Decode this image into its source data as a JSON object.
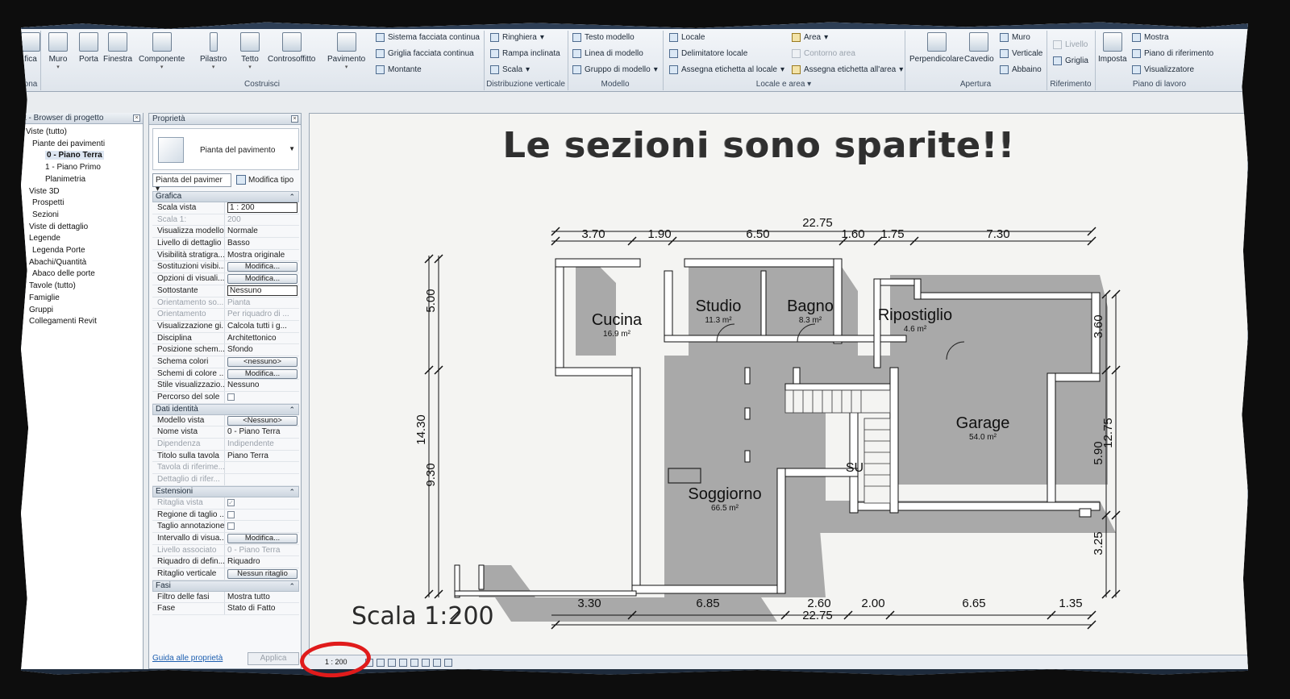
{
  "ribbon": {
    "big_tools": [
      {
        "label": "fica",
        "icon": "modify-icon"
      },
      {
        "label": "Muro",
        "icon": "wall-icon"
      },
      {
        "label": "Porta",
        "icon": "door-icon"
      },
      {
        "label": "Finestra",
        "icon": "window-icon"
      },
      {
        "label": "Componente",
        "icon": "component-icon"
      },
      {
        "label": "Pilastro",
        "icon": "column-icon"
      },
      {
        "label": "Tetto",
        "icon": "roof-icon"
      },
      {
        "label": "Controsoffitto",
        "icon": "ceiling-icon"
      },
      {
        "label": "Pavimento",
        "icon": "floor-icon"
      },
      {
        "label": "Perpendicolare",
        "icon": "shaft-perpendicular-icon"
      },
      {
        "label": "Cavedio",
        "icon": "shaft-icon"
      },
      {
        "label": "Imposta",
        "icon": "set-workplane-icon"
      }
    ],
    "small_tools": {
      "curtain_system": "Sistema facciata continua",
      "curtain_grid": "Griglia facciata continua",
      "mullion": "Montante",
      "railing": "Ringhiera",
      "ramp": "Rampa inclinata",
      "stair": "Scala",
      "model_text": "Testo modello",
      "model_line": "Linea di modello",
      "model_group": "Gruppo di modello",
      "room": "Locale",
      "room_separator": "Delimitatore  locale",
      "tag_room": "Assegna etichetta  al locale",
      "area": "Area",
      "area_boundary": "Contorno  area",
      "tag_area": "Assegna etichetta  all'area",
      "wall_opening": "Muro",
      "vertical_opening": "Verticale",
      "dormer": "Abbaino",
      "level": "Livello",
      "grid": "Griglia",
      "show": "Mostra",
      "ref_plane": "Piano di riferimento",
      "viewer": "Visualizzatore"
    },
    "panels": {
      "selection": "ona",
      "build": "Costruisci",
      "circulation": "Distribuzione verticale",
      "model": "Modello",
      "room_area": "Locale e area",
      "opening": "Apertura",
      "datum": "Riferimento",
      "work_plane": "Piano di lavoro"
    }
  },
  "browser": {
    "title": "t - Browser di progetto",
    "items": [
      {
        "label": "Viste (tutto)",
        "selected": false
      },
      {
        "label": "Piante dei pavimenti",
        "selected": false
      },
      {
        "label": "0 - Piano Terra",
        "selected": true
      },
      {
        "label": "1 - Piano Primo",
        "selected": false
      },
      {
        "label": "Planimetria",
        "selected": false
      },
      {
        "label": "Viste 3D",
        "selected": false
      },
      {
        "label": "Prospetti",
        "selected": false
      },
      {
        "label": "Sezioni",
        "selected": false
      },
      {
        "label": "Viste di dettaglio",
        "selected": false
      },
      {
        "label": "Legende",
        "selected": false
      },
      {
        "label": "Legenda Porte",
        "selected": false
      },
      {
        "label": "Abachi/Quantità",
        "selected": false
      },
      {
        "label": "Abaco delle porte",
        "selected": false
      },
      {
        "label": "Tavole (tutto)",
        "selected": false
      },
      {
        "label": "Famiglie",
        "selected": false
      },
      {
        "label": "Gruppi",
        "selected": false
      },
      {
        "label": "Collegamenti Revit",
        "selected": false
      }
    ]
  },
  "properties": {
    "title": "Proprietà",
    "type_name": "Pianta del pavimento",
    "filter_value": "Pianta del pavimer",
    "edit_type": "Modifica tipo",
    "help_link": "Guida alle proprietà",
    "apply": "Applica",
    "groups": [
      {
        "name": "Grafica",
        "rows": [
          {
            "k": "Scala vista",
            "v": "1 : 200",
            "kind": "boxed"
          },
          {
            "k": "Scala 1:",
            "v": "200",
            "kind": "ro"
          },
          {
            "k": "Visualizza modello",
            "v": "Normale"
          },
          {
            "k": "Livello di dettaglio",
            "v": "Basso"
          },
          {
            "k": "Visibilità stratigra...",
            "v": "Mostra originale"
          },
          {
            "k": "Sostituzioni visibi...",
            "v": "Modifica...",
            "kind": "btn"
          },
          {
            "k": "Opzioni di visuali...",
            "v": "Modifica...",
            "kind": "btn"
          },
          {
            "k": "Sottostante",
            "v": "Nessuno",
            "kind": "boxed"
          },
          {
            "k": "Orientamento so...",
            "v": "Pianta",
            "kind": "ro"
          },
          {
            "k": "Orientamento",
            "v": "Per riquadro di ...",
            "kind": "ro"
          },
          {
            "k": "Visualizzazione gi...",
            "v": "Calcola tutti i g..."
          },
          {
            "k": "Disciplina",
            "v": "Architettonico"
          },
          {
            "k": "Posizione schem...",
            "v": "Sfondo"
          },
          {
            "k": "Schema colori",
            "v": "<nessuno>",
            "kind": "btn"
          },
          {
            "k": "Schemi di colore ...",
            "v": "Modifica...",
            "kind": "btn"
          },
          {
            "k": "Stile visualizzazio...",
            "v": "Nessuno"
          },
          {
            "k": "Percorso del sole",
            "v": "",
            "kind": "cb"
          }
        ]
      },
      {
        "name": "Dati identità",
        "rows": [
          {
            "k": "Modello vista",
            "v": "<Nessuno>",
            "kind": "btn"
          },
          {
            "k": "Nome vista",
            "v": "0 - Piano Terra"
          },
          {
            "k": "Dipendenza",
            "v": "Indipendente",
            "kind": "ro"
          },
          {
            "k": "Titolo sulla tavola",
            "v": "Piano Terra"
          },
          {
            "k": "Tavola di riferime...",
            "v": "",
            "kind": "ro"
          },
          {
            "k": "Dettaglio di rifer...",
            "v": "",
            "kind": "ro"
          }
        ]
      },
      {
        "name": "Estensioni",
        "rows": [
          {
            "k": "Ritaglia vista",
            "v": "✓",
            "kind": "cbro"
          },
          {
            "k": "Regione di taglio ...",
            "v": "",
            "kind": "cb"
          },
          {
            "k": "Taglio annotazione",
            "v": "",
            "kind": "cb"
          },
          {
            "k": "Intervallo di visua...",
            "v": "Modifica...",
            "kind": "btn"
          },
          {
            "k": "Livello associato",
            "v": "0 - Piano Terra",
            "kind": "ro"
          },
          {
            "k": "Riquadro di defin...",
            "v": "Riquadro"
          },
          {
            "k": "Ritaglio verticale",
            "v": "Nessun ritaglio",
            "kind": "btn"
          }
        ]
      },
      {
        "name": "Fasi",
        "rows": [
          {
            "k": "Filtro delle fasi",
            "v": "Mostra tutto"
          },
          {
            "k": "Fase",
            "v": "Stato di Fatto"
          }
        ]
      }
    ]
  },
  "drawing": {
    "title": "Le sezioni sono sparite!!",
    "scale_note": "Scala 1:200",
    "rooms": [
      {
        "name": "Cucina",
        "area": "16.9 m²"
      },
      {
        "name": "Studio",
        "area": "11.3 m²"
      },
      {
        "name": "Bagno",
        "area": "8.3 m²"
      },
      {
        "name": "Ripostiglio",
        "area": "4.6 m²"
      },
      {
        "name": "Garage",
        "area": "54.0 m²"
      },
      {
        "name": "Soggiorno",
        "area": "66.5 m²"
      }
    ],
    "stair_label": "SU",
    "dims_top": [
      "3.70",
      "1.90",
      "6.50",
      "1.60",
      "1.75",
      "7.30"
    ],
    "dim_top_total": "22.75",
    "dims_bottom": [
      "3.30",
      "6.85",
      "2.60",
      "2.00",
      "6.65",
      "1.35"
    ],
    "dim_bottom_total": "22.75",
    "dims_left": [
      "5.00",
      "9.30"
    ],
    "dim_left_total": "14.30",
    "dims_right": [
      "3.60",
      "5.90",
      "3.25"
    ],
    "dim_right_total": "12.75"
  },
  "viewbar": {
    "scale": "1 : 200"
  },
  "colors": {
    "wall": "#ffffff",
    "shadow": "#a9a9a9",
    "highlight_circle": "#e01b1b"
  }
}
